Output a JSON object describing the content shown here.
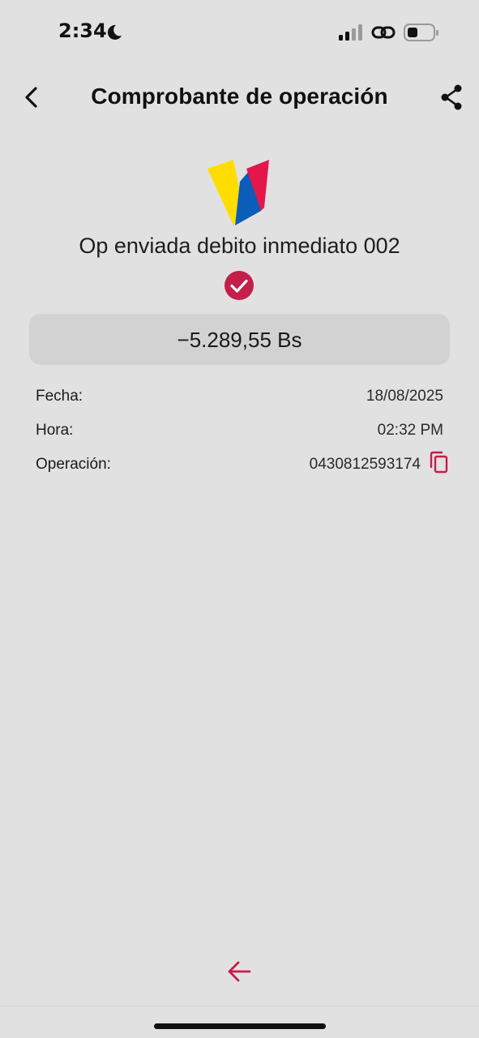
{
  "status_bar": {
    "time": "2:34"
  },
  "header": {
    "title": "Comprobante de operación"
  },
  "operation": {
    "title": "Op enviada debito inmediato 002",
    "amount": "−5.289,55 Bs"
  },
  "details": {
    "fecha_label": "Fecha:",
    "fecha_value": "18/08/2025",
    "hora_label": "Hora:",
    "hora_value": "02:32 PM",
    "operacion_label": "Operación:",
    "operacion_value": "0430812593174"
  },
  "colors": {
    "accent": "#c41e4a",
    "background": "#e1e1e1",
    "amount_box": "#d2d2d2",
    "logo_yellow": "#ffdd00",
    "logo_blue": "#0a5db8",
    "logo_red": "#e3174b"
  },
  "icons": {
    "status": [
      "moon-icon",
      "signal-icon",
      "link-icon",
      "battery-icon"
    ],
    "header": [
      "chevron-left-icon",
      "share-icon"
    ],
    "body": [
      "bank-logo",
      "check-circle-icon",
      "copy-icon"
    ],
    "footer": [
      "arrow-left-icon"
    ]
  }
}
